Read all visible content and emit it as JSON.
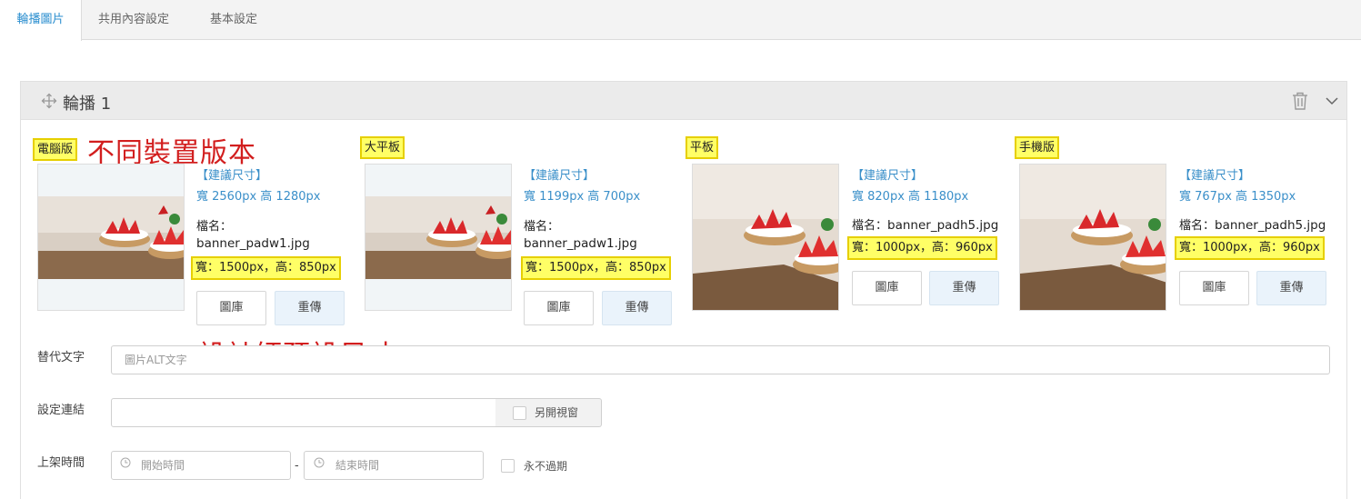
{
  "tabs": [
    {
      "label": "輪播圖片",
      "active": true
    },
    {
      "label": "共用內容設定",
      "active": false
    },
    {
      "label": "基本設定",
      "active": false
    }
  ],
  "panel": {
    "title": "輪播 1"
  },
  "annotations": {
    "devices": "不同裝置版本",
    "designer": "設計師預設尺寸"
  },
  "devices": [
    {
      "label": "電腦版",
      "suggest_title": "【建議尺寸】",
      "suggest_size": "寬 2560px 高 1280px",
      "file_label": "檔名：",
      "file_name": "banner_padw1.jpg",
      "designer_size": "寬：1500px，高：850px",
      "gallery": "圖庫",
      "reupload": "重傳"
    },
    {
      "label": "大平板",
      "suggest_title": "【建議尺寸】",
      "suggest_size": "寬 1199px 高 700px",
      "file_label": "檔名：",
      "file_name": "banner_padw1.jpg",
      "designer_size": "寬：1500px，高：850px",
      "gallery": "圖庫",
      "reupload": "重傳"
    },
    {
      "label": "平板",
      "suggest_title": "【建議尺寸】",
      "suggest_size": "寬 820px 高 1180px",
      "file_label": "檔名：",
      "file_name": "banner_padh5.jpg",
      "designer_size": "寬：1000px，高：960px",
      "gallery": "圖庫",
      "reupload": "重傳"
    },
    {
      "label": "手機版",
      "suggest_title": "【建議尺寸】",
      "suggest_size": "寬 767px 高 1350px",
      "file_label": "檔名：",
      "file_name": "banner_padh5.jpg",
      "designer_size": "寬：1000px，高：960px",
      "gallery": "圖庫",
      "reupload": "重傳"
    }
  ],
  "form": {
    "alt_label": "替代文字",
    "alt_placeholder": "圖片ALT文字",
    "link_label": "設定連結",
    "link_value": "",
    "new_window": "另開視窗",
    "time_label": "上架時間",
    "start_placeholder": "開始時間",
    "dash": "-",
    "end_placeholder": "結束時間",
    "never_expire": "永不過期"
  },
  "colors": {
    "accent": "#2a8ecf",
    "highlight": "#ffff66",
    "annotation": "#d21e1e"
  }
}
